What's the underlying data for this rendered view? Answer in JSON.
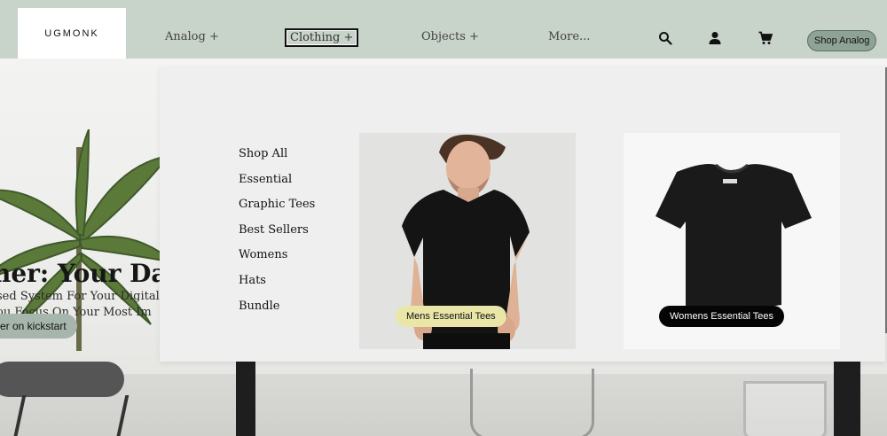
{
  "header": {
    "logo": "UGMONK",
    "nav": [
      {
        "label": "Analog +"
      },
      {
        "label": "Clothing +"
      },
      {
        "label": "Objects +"
      },
      {
        "label": "More..."
      }
    ],
    "icons": [
      "search-icon",
      "account-icon",
      "cart-icon"
    ],
    "shop_button": "Shop Analog"
  },
  "hero": {
    "title": "her: Your Da",
    "subtitle_line1": "sed System For Your Digital T",
    "subtitle_line2": "ou Focus On Your Most Im",
    "cta": "er on kickstart"
  },
  "dropdown": {
    "links": [
      {
        "label": "Shop All"
      },
      {
        "label": "Essential"
      },
      {
        "label": "Graphic Tees"
      },
      {
        "label": "Best Sellers"
      },
      {
        "label": "Womens"
      },
      {
        "label": "Hats"
      },
      {
        "label": "Bundle"
      }
    ],
    "cards": [
      {
        "label": "Mens Essential Tees"
      },
      {
        "label": "Womens Essential Tees"
      }
    ]
  },
  "colors": {
    "header_bg": "#c8d3c9",
    "shop_button_bg": "#8ea396",
    "mens_pill": "#eae6a8",
    "womens_pill": "#050505"
  }
}
